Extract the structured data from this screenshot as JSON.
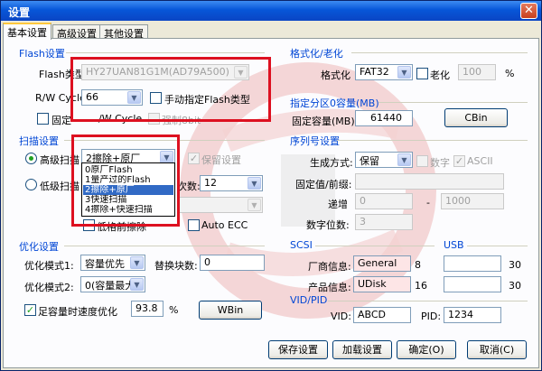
{
  "window": {
    "title": "设置",
    "close_glyph": "✕"
  },
  "tabs": [
    "基本设置",
    "高级设置",
    "其他设置"
  ],
  "flash": {
    "group_title": "Flash设置",
    "type_label": "Flash类型:",
    "type_value": "HY27UAN81G1M(AD79A500)",
    "rw_label": "R/W Cycle",
    "rw_value": "66",
    "manual_label": "手动指定Flash类型",
    "fixed_label": "固定",
    "fixed_suffix": "/W Cycle",
    "force_label": "强制8bit"
  },
  "scan": {
    "group_title": "扫描设置",
    "adv_label": "高级扫描",
    "low_label": "低级扫描",
    "mode_value": "2擦除+原厂",
    "keep_label": "保留设置",
    "count_label": "次数:",
    "count_value": "12",
    "erase_label": "低格前擦除",
    "ecc_label": "Auto ECC",
    "options": [
      "0原厂Flash",
      "1量产过的Flash",
      "2擦除+原厂",
      "3快速扫描",
      "4擦除+快速扫描"
    ],
    "selected_index": 2
  },
  "opt": {
    "group_title": "优化设置",
    "mode1_label": "优化模式1:",
    "mode1_value": "容量优先",
    "replace_label": "替换块数:",
    "replace_value": "0",
    "mode2_label": "优化模式2:",
    "mode2_value": "0(容量最大",
    "full_label": "足容量时速度优化",
    "full_value": "93.8",
    "pct": "%",
    "wbin": "WBin"
  },
  "format": {
    "group_title": "格式化/老化",
    "fmt_label": "格式化",
    "fmt_value": "FAT32",
    "aging_label": "老化",
    "aging_value": "100",
    "pct": "%"
  },
  "part": {
    "group_title": "指定分区0容量(MB)",
    "fixed_label": "固定容量(MB):",
    "fixed_value": "61440",
    "cbin": "CBin"
  },
  "serial": {
    "group_title": "序列号设置",
    "gen_label": "生成方式:",
    "gen_value": "保留",
    "digit_label": "数字",
    "ascii_label": "ASCII",
    "prefix_label": "固定值/前缀:",
    "step_label": "递增",
    "step_from": "0",
    "dash": "-",
    "step_to": "1000",
    "digits_label": "数字位数:",
    "digits_value": "3"
  },
  "scsi": {
    "group_title": "SCSI",
    "vendor_label": "厂商信息:",
    "vendor_value": "General",
    "vendor_len": "8",
    "product_label": "产品信息:",
    "product_value": "UDisk",
    "product_len": "16"
  },
  "usb": {
    "group_title": "USB",
    "len1": "30",
    "len2": "30"
  },
  "vidpid": {
    "group_title": "VID/PID",
    "vid_label": "VID:",
    "vid_value": "ABCD",
    "pid_label": "PID:",
    "pid_value": "1234"
  },
  "buttons": {
    "save": "保存设置",
    "load": "加载设置",
    "ok": "确定(O)",
    "cancel": "取消(C)"
  },
  "colors": {
    "title_bar": "#0756d8",
    "group_title": "#0046d5",
    "highlight": "#dd1020",
    "selection": "#316ac5",
    "check": "#21a121"
  }
}
